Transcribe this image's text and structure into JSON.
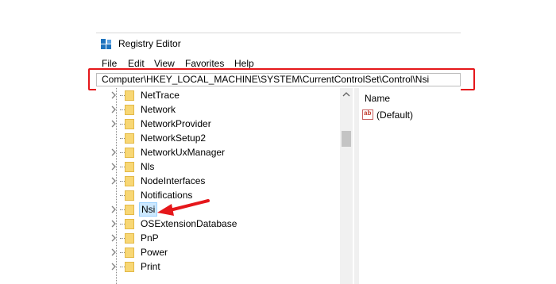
{
  "window": {
    "title": "Registry Editor",
    "icon": "registry-editor-icon"
  },
  "menu": [
    "File",
    "Edit",
    "View",
    "Favorites",
    "Help"
  ],
  "address_bar": {
    "path": "Computer\\HKEY_LOCAL_MACHINE\\SYSTEM\\CurrentControlSet\\Control\\Nsi",
    "highlight_color": "#e5171b"
  },
  "tree": {
    "items": [
      {
        "label": "NetTrace",
        "expandable": true
      },
      {
        "label": "Network",
        "expandable": true
      },
      {
        "label": "NetworkProvider",
        "expandable": true
      },
      {
        "label": "NetworkSetup2",
        "expandable": false
      },
      {
        "label": "NetworkUxManager",
        "expandable": true
      },
      {
        "label": "Nls",
        "expandable": true
      },
      {
        "label": "NodeInterfaces",
        "expandable": true
      },
      {
        "label": "Notifications",
        "expandable": false
      },
      {
        "label": "Nsi",
        "expandable": true,
        "selected": true
      },
      {
        "label": "OSExtensionDatabase",
        "expandable": true
      },
      {
        "label": "PnP",
        "expandable": true
      },
      {
        "label": "Power",
        "expandable": true
      },
      {
        "label": "Print",
        "expandable": true
      }
    ],
    "folder_color": "#f8d775"
  },
  "values_pane": {
    "column_header": "Name",
    "values": [
      {
        "icon": "string-value-icon",
        "icon_text": "ab",
        "name": "(Default)"
      }
    ]
  },
  "annotation": {
    "arrow_color": "#e5171b"
  }
}
